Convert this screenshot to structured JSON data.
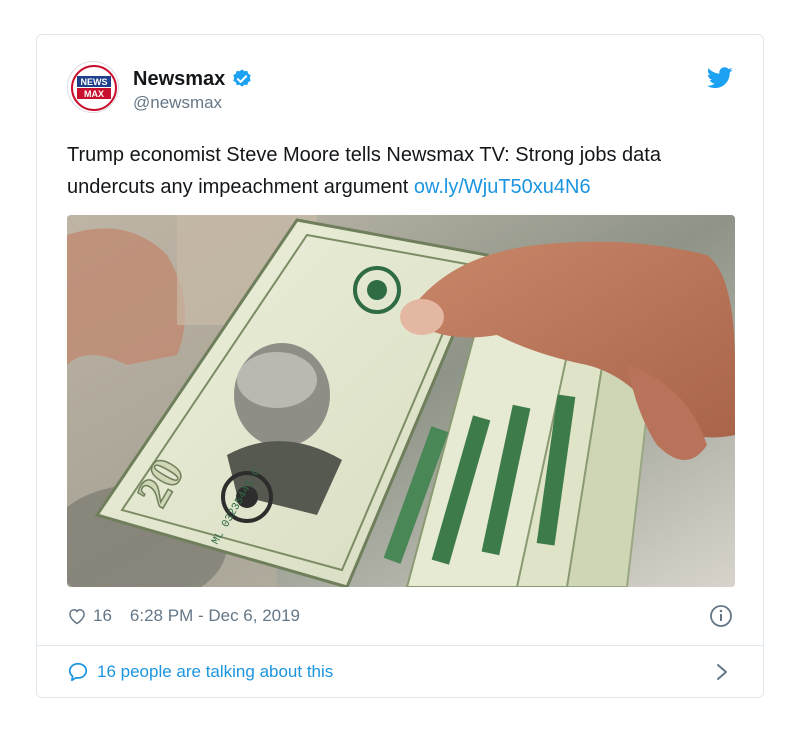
{
  "account": {
    "display_name": "Newsmax",
    "handle": "@newsmax",
    "avatar_logo_text": "NEWSMAX",
    "verified": true
  },
  "tweet": {
    "text": "Trump economist Steve Moore tells Newsmax TV: Strong jobs data undercuts any impeachment argument",
    "link": "ow.ly/WjuT50xu4N6",
    "image_description_icon": "photo-of-hand-holding-twenty-dollar-bills"
  },
  "meta": {
    "like_count": "16",
    "timestamp": "6:28 PM - Dec 6, 2019"
  },
  "footer": {
    "talking_label": "16 people are talking about this"
  },
  "colors": {
    "link": "#1b95e0",
    "text": "#14171a",
    "muted": "#657786",
    "border": "#e1e8ed",
    "verified": "#1da1f2",
    "brand_red": "#c8102e",
    "brand_blue": "#1d3f8c"
  },
  "icons": [
    "verified-badge-icon",
    "twitter-bird-icon",
    "heart-icon",
    "info-icon",
    "speech-bubble-icon",
    "chevron-right-icon"
  ]
}
